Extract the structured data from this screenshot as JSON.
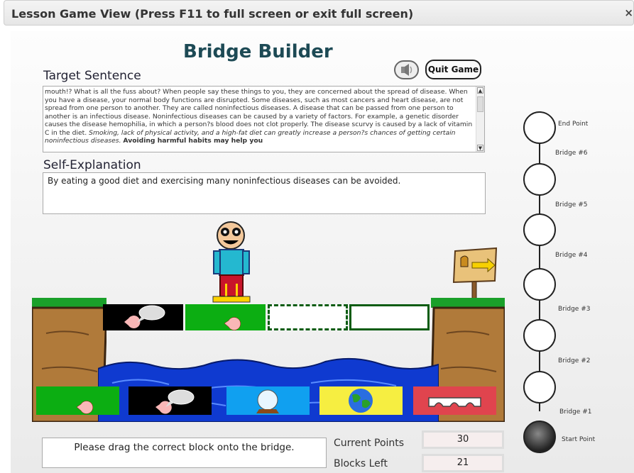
{
  "window": {
    "title": "Lesson Game View (Press F11 to full screen or exit full screen)",
    "close": "×"
  },
  "game": {
    "title": "Bridge Builder",
    "quit_label": "Quit Game",
    "target_label": "Target Sentence",
    "target_text": "mouth!? What is all the fuss about? When people say these things to you, they are concerned about the spread of disease. When you have a disease, your normal body functions are disrupted. Some diseases, such as most cancers and heart disease, are not spread from one person to another. They are called noninfectious diseases. A disease that can be passed from one person to another is an infectious disease. Noninfectious diseases can be caused by a variety of factors. For example, a genetic disorder causes the disease hemophilia, in which a person?s blood does not clot properly. The disease scurvy is caused by a lack of vitamin C in the diet.",
    "target_italic": "Smoking, lack of physical activity, and a high-fat diet can greatly increase a person?s chances of getting certain noninfectious diseases.",
    "target_bold": "Avoiding harmful habits may help you",
    "explain_label": "Self-Explanation",
    "explain_text": "By eating a good diet and exercising many noninfectious diseases can be avoided.",
    "message": "Please drag the correct block onto the bridge.",
    "points_label": "Current Points",
    "points": "30",
    "blocks_label": "Blocks Left",
    "blocks": "21"
  },
  "bridge_slots": [
    {
      "state": "filled",
      "icon": "speech-pacman",
      "color": "#000000"
    },
    {
      "state": "filled",
      "icon": "pacman",
      "color": "#0cae12"
    },
    {
      "state": "dashed"
    },
    {
      "state": "empty"
    }
  ],
  "palette": [
    {
      "icon": "pacman",
      "color": "#0cae12"
    },
    {
      "icon": "speech-pacman",
      "color": "#000000"
    },
    {
      "icon": "crystal-ball",
      "color": "#10a0f0"
    },
    {
      "icon": "globe",
      "color": "#f6ee41"
    },
    {
      "icon": "arch-bridge",
      "color": "#e0444e"
    }
  ],
  "progress": {
    "end": "End Point",
    "bridges": [
      "Bridge #6",
      "Bridge #5",
      "Bridge #4",
      "Bridge #3",
      "Bridge #2",
      "Bridge #1"
    ],
    "start": "Start Point"
  }
}
